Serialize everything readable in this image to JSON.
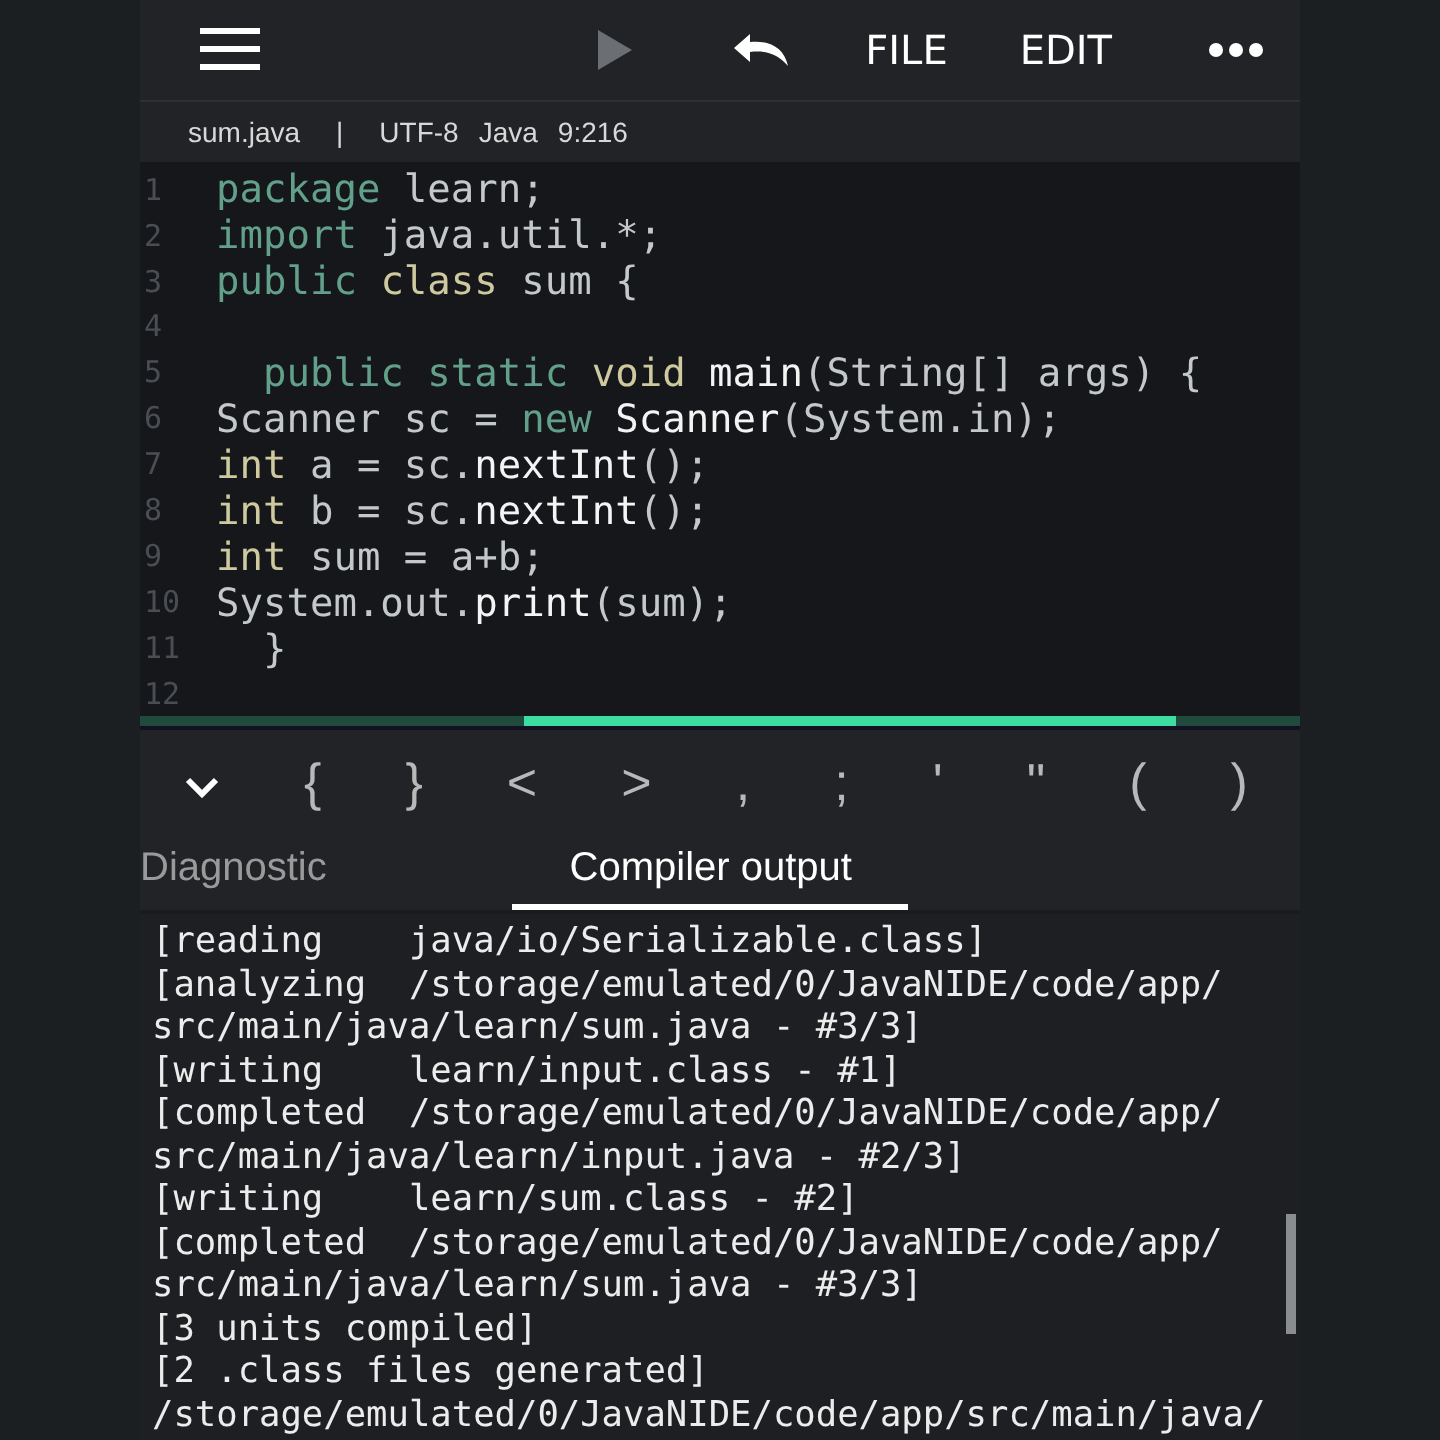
{
  "toolbar": {
    "actions": [
      {
        "kind": "run",
        "disabled": true
      },
      {
        "kind": "undo",
        "disabled": false
      },
      {
        "kind": "text",
        "label": "FILE"
      },
      {
        "kind": "text",
        "label": "EDIT"
      },
      {
        "kind": "more"
      }
    ]
  },
  "status": [
    "sum.java",
    "|",
    "UTF-8",
    "Java",
    "9:216"
  ],
  "code": [
    {
      "n": "1",
      "tokens": [
        {
          "kind": "keyword",
          "text": "package"
        },
        {
          "kind": "plain",
          "text": " learn;"
        }
      ]
    },
    {
      "n": "2",
      "tokens": [
        {
          "kind": "keyword",
          "text": "import"
        },
        {
          "kind": "plain",
          "text": " java.util.*;"
        }
      ]
    },
    {
      "n": "3",
      "tokens": [
        {
          "kind": "keyword",
          "text": "public"
        },
        {
          "kind": "type",
          "text": " class"
        },
        {
          "kind": "plain",
          "text": " sum {"
        }
      ]
    },
    {
      "n": "4"
    },
    {
      "n": "5",
      "tokens": [
        {
          "kind": "keyword",
          "text": "  public static"
        },
        {
          "kind": "type",
          "text": " void"
        },
        {
          "kind": "name",
          "text": " main"
        },
        {
          "kind": "plain",
          "text": "(String[] args) {"
        }
      ]
    },
    {
      "n": "6",
      "tokens": [
        {
          "kind": "plain",
          "text": "Scanner sc = "
        },
        {
          "kind": "keyword",
          "text": "new"
        },
        {
          "kind": "name",
          "text": " Scanner"
        },
        {
          "kind": "plain",
          "text": "(System.in);"
        }
      ]
    },
    {
      "n": "7",
      "tokens": [
        {
          "kind": "type",
          "text": "int"
        },
        {
          "kind": "plain",
          "text": " a = sc."
        },
        {
          "kind": "name",
          "text": "nextInt"
        },
        {
          "kind": "plain",
          "text": "();"
        }
      ]
    },
    {
      "n": "8",
      "tokens": [
        {
          "kind": "type",
          "text": "int"
        },
        {
          "kind": "plain",
          "text": " b = sc."
        },
        {
          "kind": "name",
          "text": "nextInt"
        },
        {
          "kind": "plain",
          "text": "();"
        }
      ]
    },
    {
      "n": "9",
      "tokens": [
        {
          "kind": "type",
          "text": "int"
        },
        {
          "kind": "plain",
          "text": " sum = a+b;"
        }
      ]
    },
    {
      "n": "10",
      "tokens": [
        {
          "kind": "plain",
          "text": "System.out."
        },
        {
          "kind": "name",
          "text": "print"
        },
        {
          "kind": "plain",
          "text": "(sum);"
        }
      ]
    },
    {
      "n": "11",
      "tokens": [
        {
          "kind": "plain",
          "text": "  }"
        }
      ]
    },
    {
      "n": "12"
    }
  ],
  "keys": [
    "{",
    "}",
    "<",
    ">",
    ",",
    ";",
    "'",
    "\"",
    "(",
    ")"
  ],
  "tabs": [
    {
      "label": "Diagnostic",
      "selected": false
    },
    {
      "label": "Compiler output",
      "selected": true
    }
  ],
  "output": [
    "[reading    java/io/Serializable.class]",
    "[analyzing  /storage/emulated/0/JavaNIDE/code/app/",
    "src/main/java/learn/sum.java - #3/3]",
    "[writing    learn/input.class - #1]",
    "[completed  /storage/emulated/0/JavaNIDE/code/app/",
    "src/main/java/learn/input.java - #2/3]",
    "[writing    learn/sum.class - #2]",
    "[completed  /storage/emulated/0/JavaNIDE/code/app/",
    "src/main/java/learn/sum.java - #3/3]",
    "[3 units compiled]",
    "[2 .class files generated]",
    "/storage/emulated/0/JavaNIDE/code/app/src/main/java/"
  ]
}
